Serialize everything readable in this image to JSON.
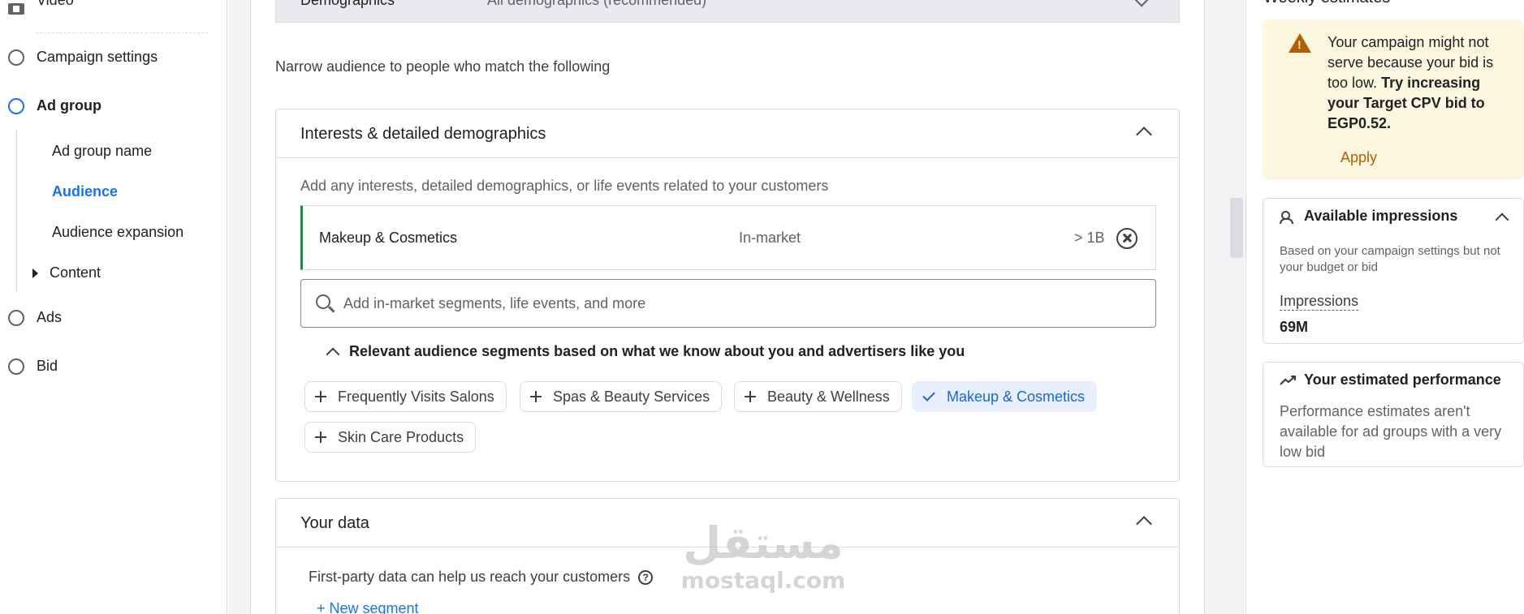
{
  "nav": {
    "video": "Video",
    "campaign_settings": "Campaign settings",
    "ad_group": "Ad group",
    "sub_ad_group_name": "Ad group name",
    "sub_audience": "Audience",
    "sub_audience_expansion": "Audience expansion",
    "sub_content": "Content",
    "ads": "Ads",
    "bid": "Bid"
  },
  "demographics": {
    "label": "Demographics",
    "value": "All demographics (recommended)"
  },
  "narrow_text": "Narrow audience to people who match the following",
  "interests": {
    "title": "Interests & detailed demographics",
    "description": "Add any interests, detailed demographics, or life events related to your customers",
    "selected": {
      "name": "Makeup & Cosmetics",
      "type": "In-market",
      "size": "> 1B"
    },
    "search_placeholder": "Add in-market segments, life events, and more",
    "relevant_title": "Relevant audience segments based on what we know about you and advertisers like you",
    "chips": [
      "Frequently Visits Salons",
      "Spas & Beauty Services",
      "Beauty & Wellness",
      "Makeup & Cosmetics",
      "Skin Care Products"
    ]
  },
  "your_data": {
    "title": "Your data",
    "description": "First-party data can help us reach your customers",
    "new_segment": "+ New segment"
  },
  "watermark": {
    "arabic": "مستقل",
    "latin": "mostaql.com"
  },
  "right": {
    "weekly_title": "Weekly estimates",
    "warning": {
      "text": "Your campaign might not serve because your bid is too low.",
      "bold": "Try increasing your Target CPV bid to EGP0.52.",
      "apply": "Apply",
      "color": "#b06000"
    },
    "impressions": {
      "title": "Available impressions",
      "description": "Based on your campaign settings but not your budget or bid",
      "label": "Impressions",
      "value": "69M"
    },
    "performance": {
      "title": "Your estimated performance",
      "description": "Performance estimates aren't available for ad groups with a very low bid"
    }
  }
}
